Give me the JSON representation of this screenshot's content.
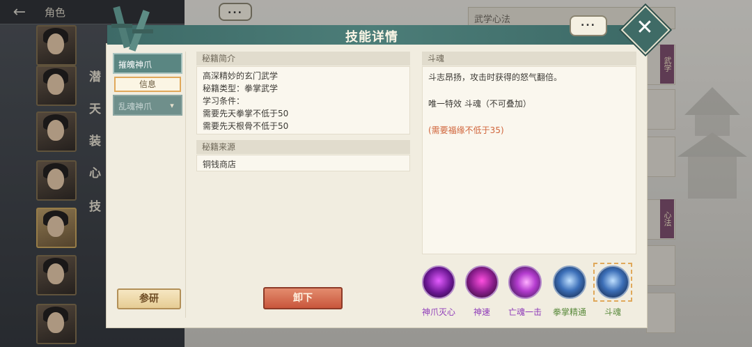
{
  "topbar": {
    "title": "角色"
  },
  "sidebar_tabs": [
    "潜",
    "天",
    "装",
    "心",
    "技"
  ],
  "background": {
    "field_label": "武学心法",
    "bubble_text": "...",
    "right_tags": [
      "武学",
      "心法"
    ]
  },
  "modal": {
    "title": "技能详情"
  },
  "left_tabs": [
    {
      "label": "摧魄神爪"
    },
    {
      "label": "信息"
    },
    {
      "label": "乱魂神爪"
    }
  ],
  "buttons": {
    "research": "参研",
    "unload": "卸下"
  },
  "intro": {
    "header": "秘籍简介",
    "lines": [
      "高深精妙的玄门武学",
      "秘籍类型：拳掌武学",
      "学习条件：",
      "需要先天拳掌不低于50",
      "需要先天根骨不低于50"
    ]
  },
  "source": {
    "header": "秘籍来源",
    "value": "铜钱商店"
  },
  "effect": {
    "header": "斗魂",
    "desc": "斗志昂扬，攻击时获得的怒气翻倍。",
    "unique": "唯一特效 斗魂（不可叠加）",
    "condition": "(需要福缘不低于35)"
  },
  "skills": [
    {
      "name": "神爪灭心",
      "color": "#8e3ab8",
      "icon": "claw-burst-icon"
    },
    {
      "name": "神速",
      "color": "#8e3ab8",
      "icon": "speed-dash-icon"
    },
    {
      "name": "亡魂一击",
      "color": "#8e3ab8",
      "icon": "spirit-strike-icon"
    },
    {
      "name": "拳掌精通",
      "color": "#5a8a3c",
      "icon": "fist-mastery-icon"
    },
    {
      "name": "斗魂",
      "color": "#5a8a3c",
      "icon": "fighting-spirit-icon"
    }
  ]
}
